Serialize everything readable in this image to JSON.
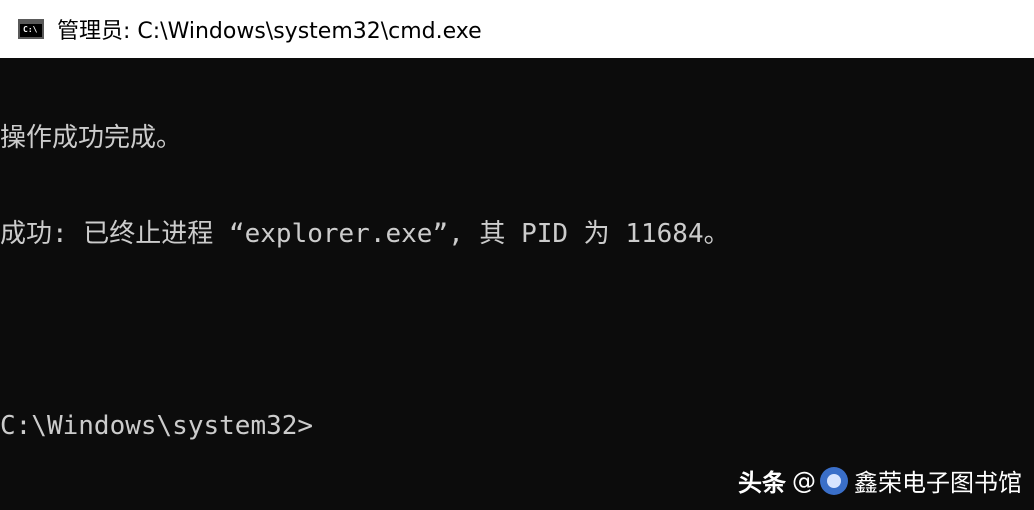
{
  "window": {
    "title": "管理员: C:\\Windows\\system32\\cmd.exe",
    "icon_name": "cmd-icon",
    "icon_glyph": "C:\\"
  },
  "console": {
    "lines": [
      "操作成功完成。",
      "成功: 已终止进程 “explorer.exe”, 其 PID 为 11684。",
      "",
      "C:\\Windows\\system32>"
    ]
  },
  "watermark": {
    "brand": "头条",
    "at": "@",
    "avatar_icon": "avatar-icon",
    "name": "鑫荣电子图书馆"
  },
  "colors": {
    "console_background": "#0c0c0c",
    "console_text": "#cccccc",
    "titlebar_background": "#ffffff",
    "title_text": "#000000"
  }
}
